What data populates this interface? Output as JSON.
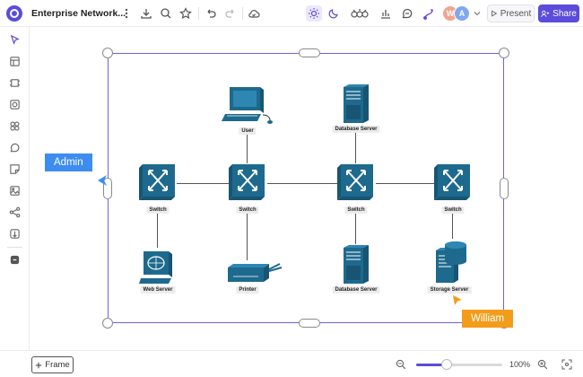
{
  "header": {
    "doc_title": "Enterprise Network...",
    "present_label": "Present",
    "share_label": "Share",
    "collaborators": [
      {
        "initial": "W",
        "color": "#f0a58e"
      },
      {
        "initial": "A",
        "color": "#7fa8ef"
      }
    ],
    "icons": [
      "more-icon",
      "download-icon",
      "search-icon",
      "star-icon",
      "undo-icon",
      "redo-icon",
      "cloud-sync-icon",
      "sun-icon",
      "moon-icon",
      "link-icon",
      "chart-icon",
      "comment-icon",
      "connector-icon"
    ]
  },
  "sidebar": {
    "items": [
      "select-tool",
      "template",
      "frame-tool",
      "shape-tool",
      "components",
      "comment",
      "sticky-note",
      "image",
      "connector",
      "embed",
      "plugin"
    ]
  },
  "diagram": {
    "accent": "#1e6a8e",
    "frame_color": "#6f63d9",
    "nodes": {
      "user": "User",
      "database_top": "Database Server",
      "switch_1": "Switch",
      "switch_2": "Switch",
      "switch_3": "Switch",
      "switch_4": "Switch",
      "web_server": "Web Server",
      "printer": "Printer",
      "database_bottom": "Database Server",
      "storage_server": "Storage Server"
    }
  },
  "cursors": {
    "admin": {
      "name": "Admin",
      "color": "#3d8df0"
    },
    "william": {
      "name": "William",
      "color": "#f39c1a"
    }
  },
  "footer": {
    "frame_label": "Frame",
    "zoom_level": "100%",
    "zoom_fraction": 0.35
  }
}
